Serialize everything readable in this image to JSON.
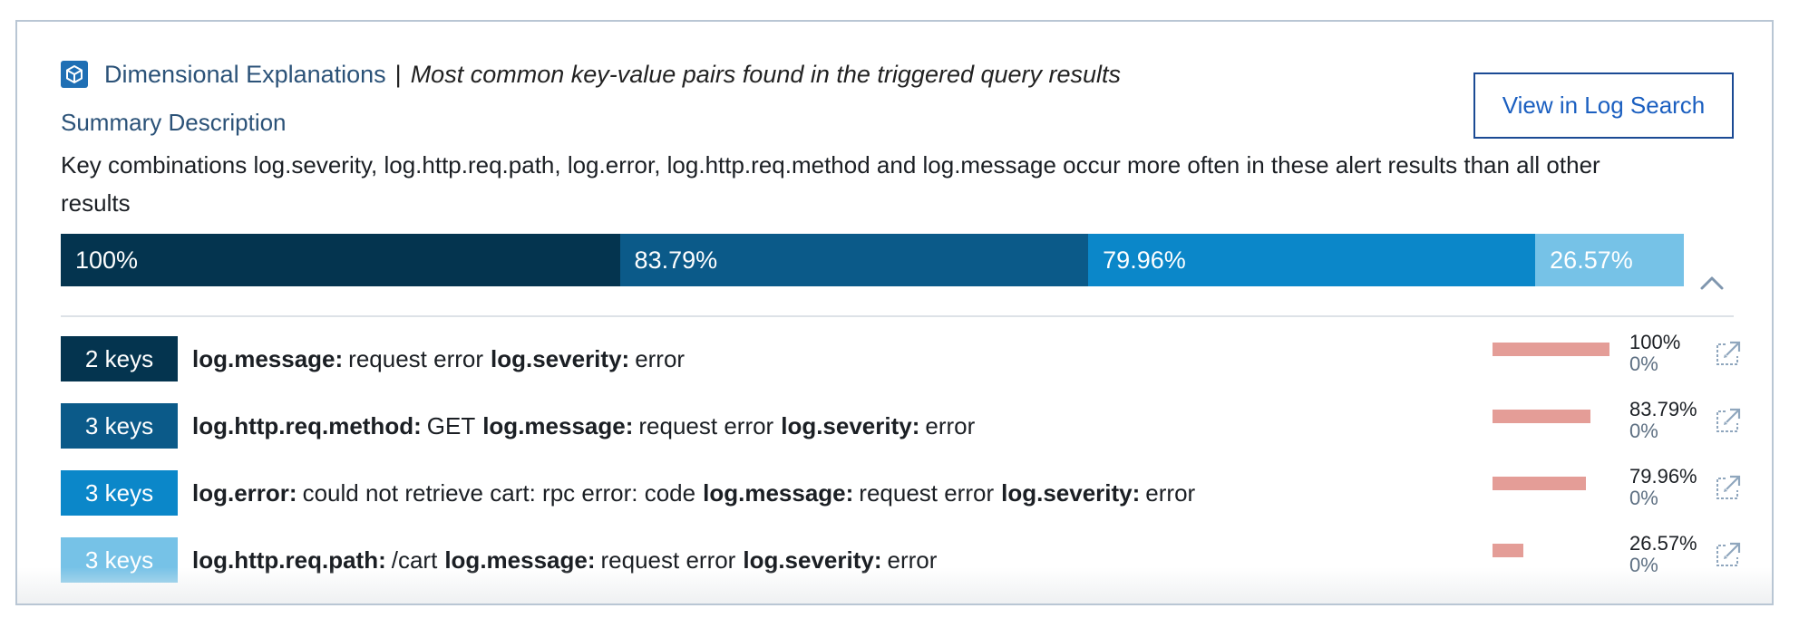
{
  "header": {
    "icon": "cube-icon",
    "title": "Dimensional Explanations",
    "separator": "|",
    "subtitle": "Most common key-value pairs found in the triggered query results"
  },
  "actions": {
    "view_log_search": "View in Log Search"
  },
  "summary": {
    "label": "Summary Description",
    "text": "Key combinations log.severity, log.http.req.path, log.error, log.http.req.method and log.message occur more often in these alert results than all other results"
  },
  "stacked_bar": {
    "segments": [
      {
        "label": "100%",
        "value": 100,
        "color": "#04344f"
      },
      {
        "label": "83.79%",
        "value": 83.79,
        "color": "#0b5a89"
      },
      {
        "label": "79.96%",
        "value": 79.96,
        "color": "#0b87c9"
      },
      {
        "label": "26.57%",
        "value": 26.57,
        "color": "#76c2e7"
      }
    ],
    "collapse_icon": "chevron-up-icon"
  },
  "rows": [
    {
      "badge": "2 keys",
      "badge_color": "#04344f",
      "pairs": [
        {
          "key": "log.message:",
          "value": "request error"
        },
        {
          "key": "log.severity:",
          "value": "error"
        }
      ],
      "pct_top": "100%",
      "pct_bottom": "0%",
      "fraction": 1.0,
      "icon": "external-link-icon"
    },
    {
      "badge": "3 keys",
      "badge_color": "#0b5a89",
      "pairs": [
        {
          "key": "log.http.req.method:",
          "value": "GET"
        },
        {
          "key": "log.message:",
          "value": "request error"
        },
        {
          "key": "log.severity:",
          "value": "error"
        }
      ],
      "pct_top": "83.79%",
      "pct_bottom": "0%",
      "fraction": 0.8379,
      "icon": "external-link-icon"
    },
    {
      "badge": "3 keys",
      "badge_color": "#0b87c9",
      "pairs": [
        {
          "key": "log.error:",
          "value": "could not retrieve cart: rpc error: code"
        },
        {
          "key": "log.message:",
          "value": "request error"
        },
        {
          "key": "log.severity:",
          "value": "error"
        }
      ],
      "pct_top": "79.96%",
      "pct_bottom": "0%",
      "fraction": 0.7996,
      "icon": "external-link-icon"
    },
    {
      "badge": "3 keys",
      "badge_color": "#76c2e7",
      "pairs": [
        {
          "key": "log.http.req.path:",
          "value": "/cart"
        },
        {
          "key": "log.message:",
          "value": "request error"
        },
        {
          "key": "log.severity:",
          "value": "error"
        }
      ],
      "pct_top": "26.57%",
      "pct_bottom": "0%",
      "fraction": 0.2657,
      "icon": "external-link-icon"
    }
  ]
}
